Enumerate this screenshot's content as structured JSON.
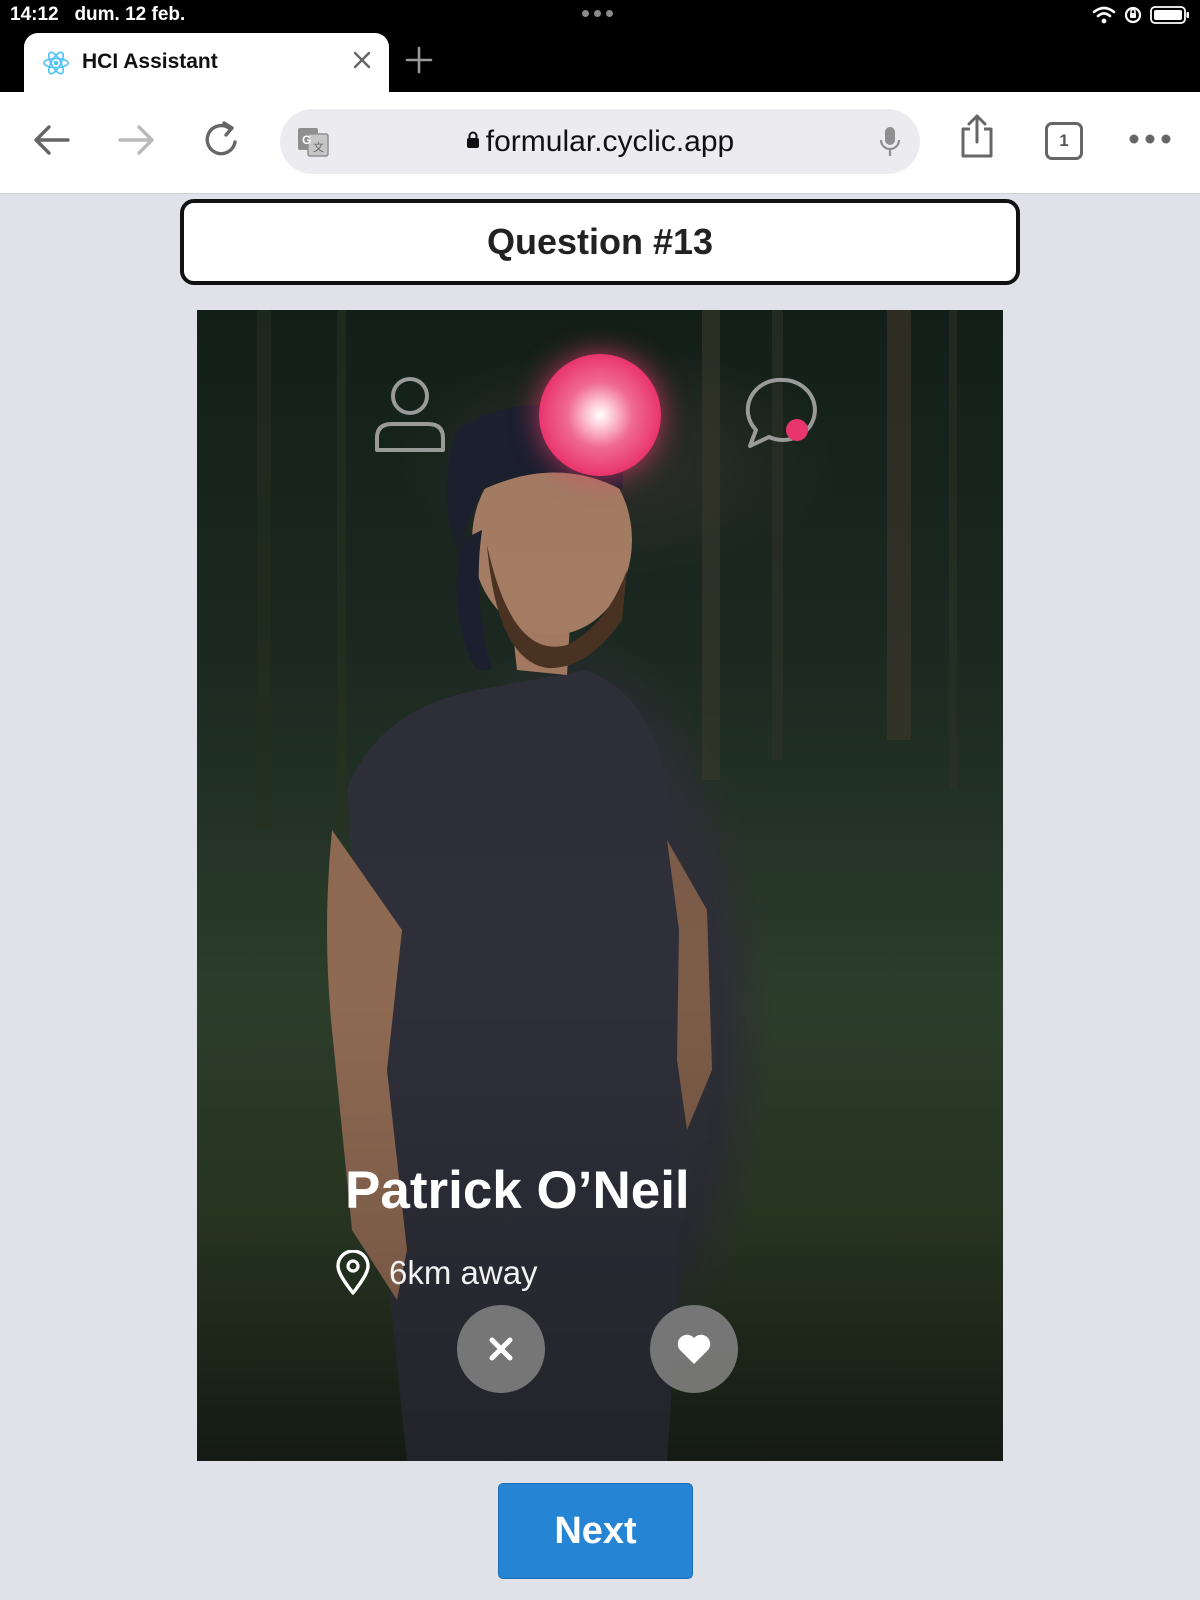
{
  "status_bar": {
    "time": "14:12",
    "date": "dum. 12 feb.",
    "icons": [
      "wifi-icon",
      "orientation-lock-icon",
      "battery-icon"
    ]
  },
  "browser": {
    "tab_title": "HCI Assistant",
    "tab_icon": "react-icon",
    "url": "formular.cyclic.app",
    "tab_count": "1"
  },
  "page": {
    "question_title": "Question #13",
    "next_label": "Next"
  },
  "profile": {
    "name": "Patrick O’Neil",
    "distance": "6km away",
    "accent_color": "#e9356e"
  },
  "colors": {
    "background": "#e1e1ea",
    "next_button": "#2584d4"
  }
}
